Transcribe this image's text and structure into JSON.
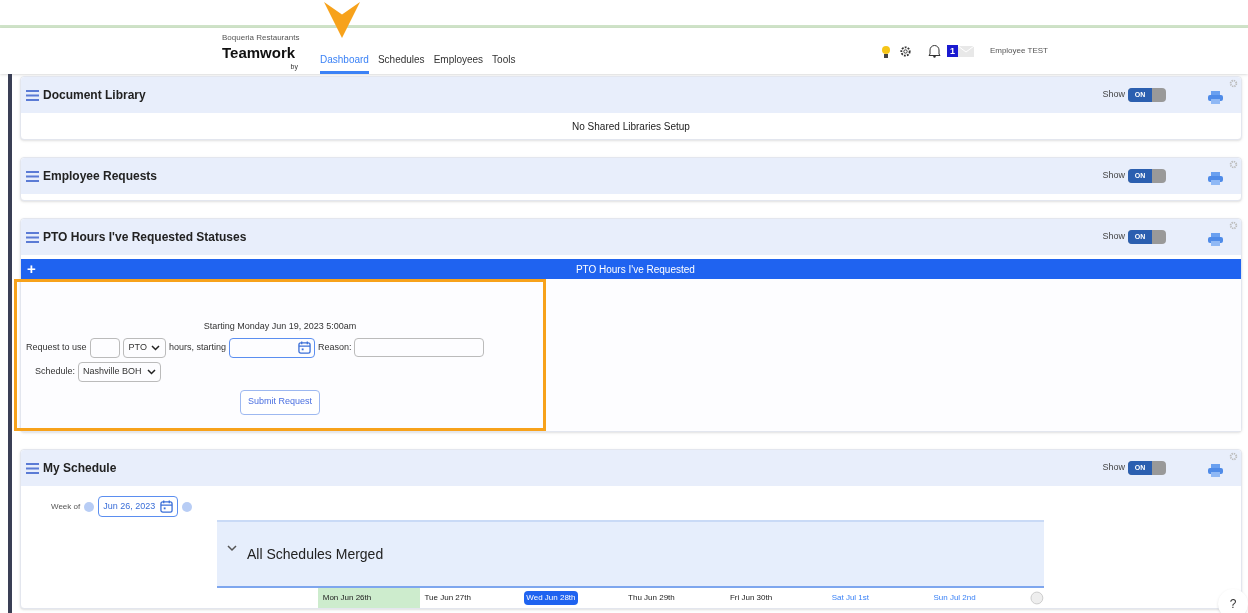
{
  "header": {
    "company": "Boqueria Restaurants",
    "logo": "Teamwork",
    "logo_sub": "by",
    "nav": [
      {
        "label": "Dashboard",
        "selected": true
      },
      {
        "label": "Schedules",
        "selected": false
      },
      {
        "label": "Employees",
        "selected": false
      },
      {
        "label": "Tools",
        "selected": false
      }
    ],
    "notification_count": "1",
    "user": "Employee TEST"
  },
  "panels": [
    {
      "title": "Document Library",
      "show_label": "Show",
      "show_on": true,
      "toggle_label": "ON",
      "kind": "message",
      "message": "No Shared Libraries Setup"
    },
    {
      "title": "Employee Requests",
      "show_label": "Show",
      "show_on": true,
      "toggle_label": "ON",
      "kind": "empty"
    },
    {
      "title": "PTO Hours I've Requested Statuses",
      "show_label": "Show",
      "show_on": true,
      "toggle_label": "ON",
      "kind": "pto"
    },
    {
      "title": "My Schedule",
      "show_label": "Show",
      "show_on": true,
      "toggle_label": "ON",
      "kind": "schedule"
    }
  ],
  "pto": {
    "bar_icon": "+",
    "bar_title": "PTO Hours I've Requested",
    "starting": "Starting Monday Jun 19, 2023 5:00am",
    "request_label": "Request to use",
    "type_value": "PTO",
    "hours_label": "hours, starting",
    "reason_label": "Reason:",
    "schedule_label": "Schedule:",
    "schedule_value": "Nashville BOH",
    "submit": "Submit Request"
  },
  "schedule": {
    "week_label": "Week of",
    "week_value": "Jun 26, 2023",
    "group_title": "All Schedules Merged",
    "days": [
      {
        "label": "Mon Jun 26th",
        "today": true,
        "selected": false,
        "weekend": false
      },
      {
        "label": "Tue Jun 27th",
        "today": false,
        "selected": false,
        "weekend": false
      },
      {
        "label": "Wed Jun 28th",
        "today": false,
        "selected": true,
        "weekend": false
      },
      {
        "label": "Thu Jun 29th",
        "today": false,
        "selected": false,
        "weekend": false
      },
      {
        "label": "Fri Jun 30th",
        "today": false,
        "selected": false,
        "weekend": false
      },
      {
        "label": "Sat Jul 1st",
        "today": false,
        "selected": false,
        "weekend": true
      },
      {
        "label": "Sun Jul 2nd",
        "today": false,
        "selected": false,
        "weekend": true
      }
    ]
  },
  "help": "?"
}
